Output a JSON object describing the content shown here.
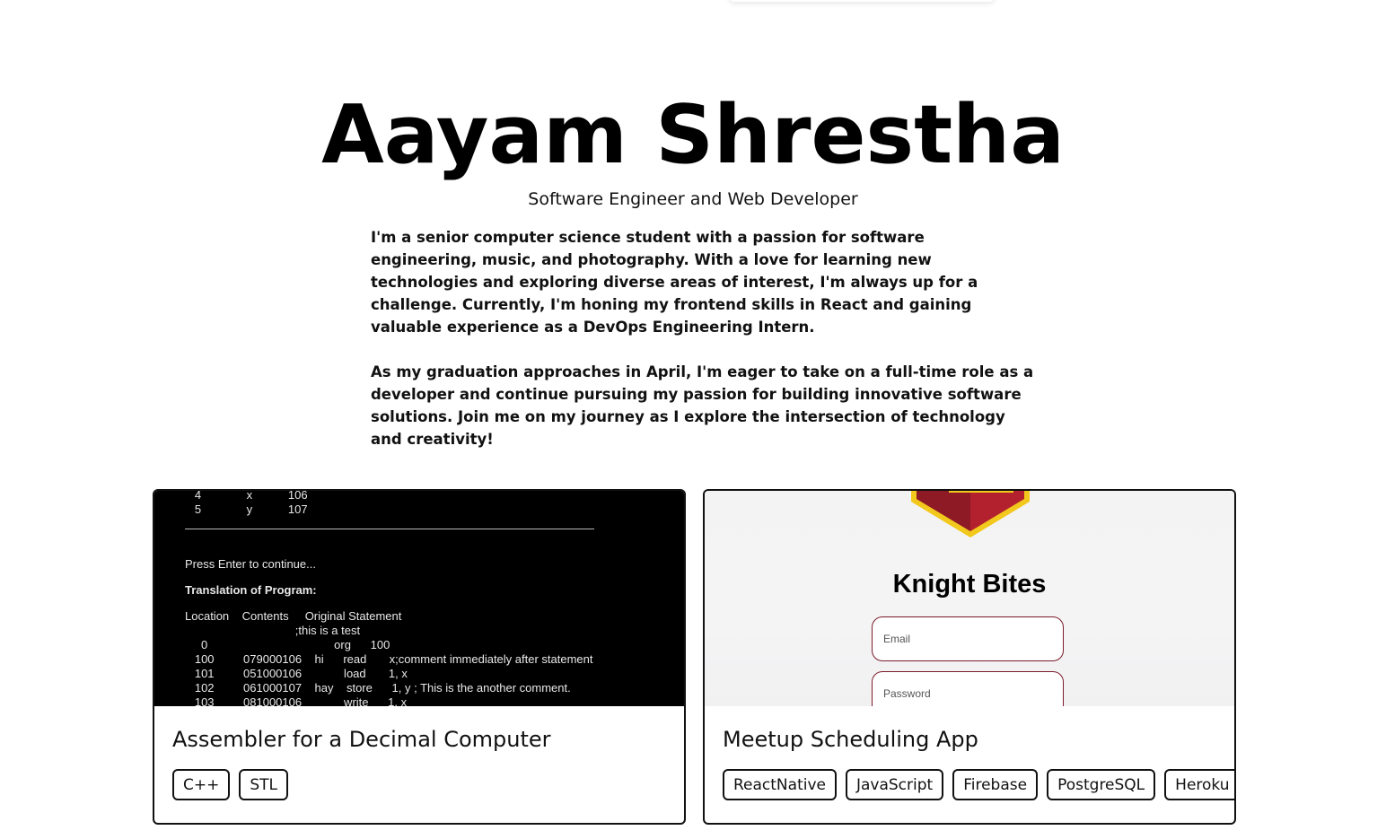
{
  "hero": {
    "name": "Aayam Shrestha",
    "subtitle": "Software Engineer and Web Developer"
  },
  "bio": {
    "paragraph_1": "I'm a senior computer science student with a passion for software engineering, music, and photography. With a love for learning new technologies and exploring diverse areas of interest, I'm always up for a challenge. Currently, I'm honing my frontend skills in React and gaining valuable experience as a DevOps Engineering Intern.",
    "paragraph_2": "As my graduation approaches in April, I'm eager to take on a full-time role as a developer and continue pursuing my passion for building innovative software solutions. Join me on my journey as I explore the intersection of technology and creativity!"
  },
  "projects": [
    {
      "title": "Assembler for a Decimal Computer",
      "tags": [
        "C++",
        "STL"
      ],
      "thumbnail": {
        "lines": [
          "   4              x           106",
          "   5              y           107",
          "Press Enter to continue...",
          "Translation of Program:",
          "Location    Contents     Original Statement",
          "                                  ;this is a test",
          "     0                                       org      100",
          "   100         079000106    hi      read       x;comment immediately after statement",
          "   101         051000106             load       1, x",
          "   102         061000107    hay    store      1, y ; This is the another comment.",
          "   103         081000106             write      1, x"
        ]
      }
    },
    {
      "title": "Meetup Scheduling App",
      "tags": [
        "ReactNative",
        "JavaScript",
        "Firebase",
        "PostgreSQL",
        "Heroku"
      ],
      "thumbnail": {
        "app_title": "Knight Bites",
        "email_placeholder": "Email",
        "password_placeholder": "Password"
      }
    }
  ],
  "colors": {
    "text": "#111111",
    "terminal_bg": "#000000",
    "shield_red": "#b3202e",
    "shield_gold": "#f2c81c",
    "input_border": "#7a1b2a"
  }
}
